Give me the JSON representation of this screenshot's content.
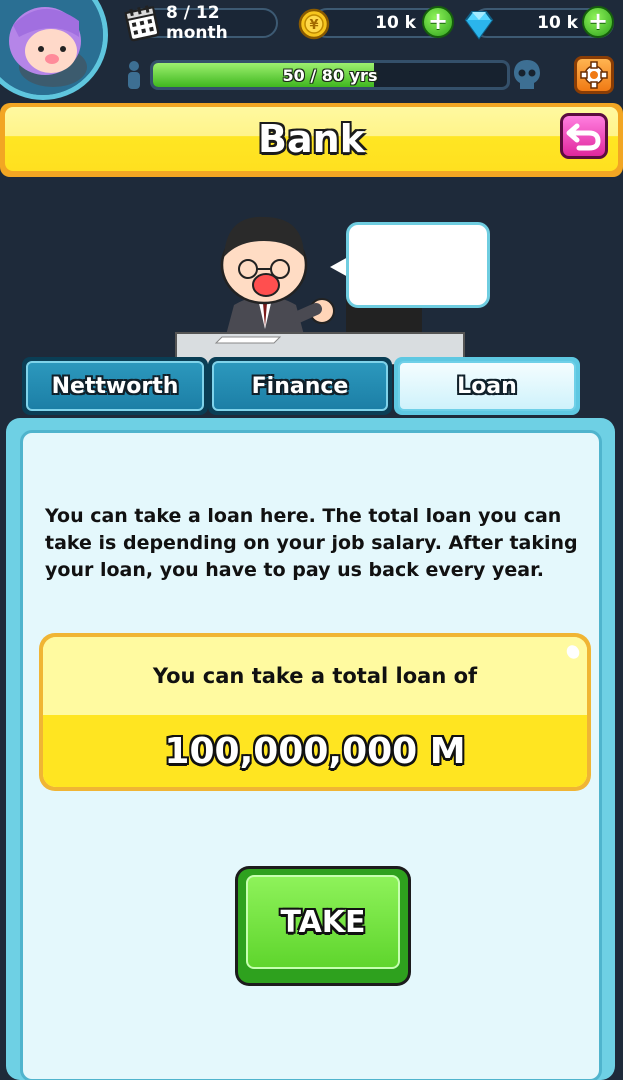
{
  "hud": {
    "month": "8 / 12 month",
    "coins": "10 k",
    "gems": "10 k",
    "age_text": "50 / 80 yrs",
    "age_progress": 0.625
  },
  "title": "Bank",
  "tabs": [
    {
      "label": "Nettworth",
      "active": false
    },
    {
      "label": "Finance",
      "active": false
    },
    {
      "label": "Loan",
      "active": true
    }
  ],
  "loan": {
    "description": "You can take a loan here. The total loan you can take is depending on your job salary. After taking your loan, you have to pay us back every year.",
    "total_label": "You can take a total loan of",
    "amount": "100,000,000 M",
    "take_label": "TAKE"
  },
  "icons": {
    "calendar": "calendar-icon",
    "coin": "coin-icon",
    "gem": "gem-icon",
    "person": "person-icon",
    "skull": "skull-icon",
    "settings": "gear-icon",
    "back": "back-arrow-icon"
  },
  "colors": {
    "background": "#1e2a3a",
    "title_yellow": "#ffe020",
    "tab_blue": "#1c7fa6",
    "panel_cyan": "#6ed0e4",
    "take_green": "#5fd52d",
    "back_pink": "#e0279c",
    "settings_orange": "#f07a14"
  }
}
